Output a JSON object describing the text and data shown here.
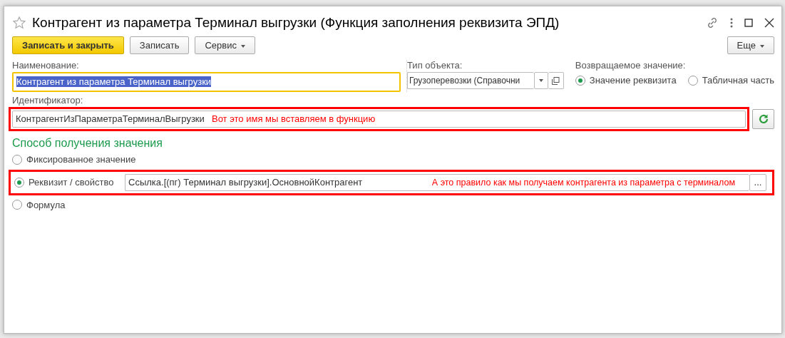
{
  "window": {
    "title": "Контрагент из параметра Терминал выгрузки (Функция заполнения реквизита ЭПД)",
    "favorite": false
  },
  "toolbar": {
    "buttons": [
      {
        "label": "Записать и закрыть",
        "kind": "primary"
      },
      {
        "label": "Записать",
        "kind": "plain"
      },
      {
        "label": "Сервис",
        "kind": "menu"
      }
    ],
    "more": {
      "label": "Еще"
    }
  },
  "name_field": {
    "label": "Наименование:",
    "value": "Контрагент из параметра Терминал выгрузки",
    "focused": true,
    "text_selected": true
  },
  "object_type": {
    "label": "Тип объекта:",
    "value": "Грузоперевозки (Справочни"
  },
  "return_value": {
    "label": "Возвращаемое значение:",
    "options": [
      {
        "label": "Значение реквизита",
        "selected": true
      },
      {
        "label": "Табличная часть",
        "selected": false
      }
    ]
  },
  "identifier": {
    "label": "Идентификатор:",
    "value": "КонтрагентИзПараметраТерминалВыгрузки",
    "annotation": "Вот это имя мы вставляем в функцию"
  },
  "method": {
    "heading": "Способ получения значения",
    "options": [
      {
        "label": "Фиксированное значение",
        "selected": false
      },
      {
        "label": "Реквизит / свойство",
        "selected": true,
        "value": "Ссылка.[(пг) Терминал выгрузки].ОсновнойКонтрагент",
        "annotation": "А это правило как мы получаем контрагента из параметра с терминалом",
        "select_label": "..."
      },
      {
        "label": "Формула",
        "selected": false
      }
    ]
  }
}
